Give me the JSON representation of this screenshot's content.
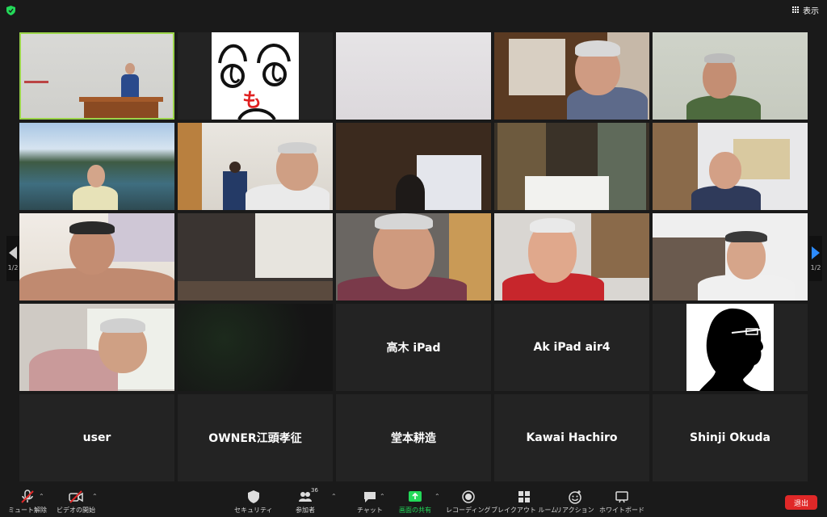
{
  "topbar": {
    "view_label": "表示"
  },
  "tiles": {
    "takagi": "高木 iPad",
    "ak": "Ak iPad air4",
    "user": "user",
    "owner": "OWNER江頭孝征",
    "domoto": "堂本耕造",
    "kawai": "Kawai Hachiro",
    "okuda": "Shinji Okuda",
    "drawing_char": "も"
  },
  "nav": {
    "page_left": "1/2",
    "page_right": "1/2"
  },
  "toolbar": {
    "mute": "ミュート解除",
    "video": "ビデオの開始",
    "security": "セキュリティ",
    "participants": "参加者",
    "participants_count": "36",
    "chat": "チャット",
    "share": "画面の共有",
    "record": "レコーディング",
    "breakout": "ブレイクアウト ルーム",
    "reaction": "リアクション",
    "whiteboard": "ホワイトボード",
    "leave": "退出"
  },
  "colors": {
    "accent_green": "#9bd54a",
    "share_green": "#23d959",
    "leave_red": "#e02828",
    "nav_blue": "#2d8cff"
  }
}
